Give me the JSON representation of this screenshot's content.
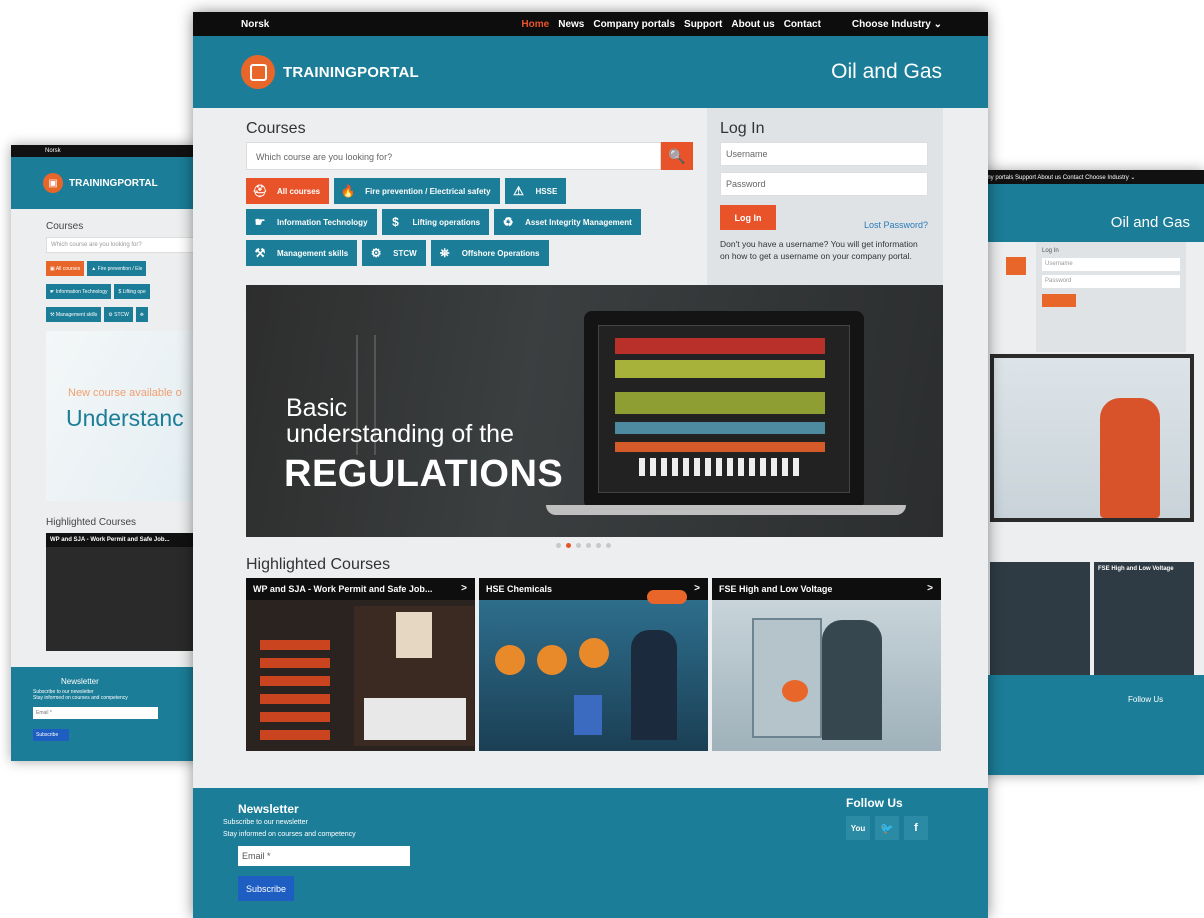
{
  "top_nav": {
    "language": "Norsk",
    "items": [
      "Home",
      "News",
      "Company portals",
      "Support",
      "About us",
      "Contact"
    ],
    "active": "Home",
    "industry_label": "Choose Industry",
    "industry_arrow": "⌄"
  },
  "header": {
    "brand": "TRAININGPORTAL",
    "industry": "Oil and Gas"
  },
  "courses": {
    "title": "Courses",
    "search_placeholder": "Which course are you looking for?",
    "search_icon": "🔍",
    "categories": [
      [
        {
          "label": "All courses",
          "icon": "⛑"
        },
        {
          "label": "Fire prevention / Electrical safety",
          "icon": "🔥"
        },
        {
          "label": "HSSE",
          "icon": "⚠"
        }
      ],
      [
        {
          "label": "Information Technology",
          "icon": "☛"
        },
        {
          "label": "Lifting operations",
          "icon": "$"
        },
        {
          "label": "Asset Integrity Management",
          "icon": "♻"
        }
      ],
      [
        {
          "label": "Management skills",
          "icon": "⚒"
        },
        {
          "label": "STCW",
          "icon": "⚙"
        },
        {
          "label": "Offshore Operations",
          "icon": "⛯"
        }
      ]
    ]
  },
  "login": {
    "title": "Log In",
    "username_placeholder": "Username",
    "password_placeholder": "Password",
    "button": "Log In",
    "lost_password": "Lost Password?",
    "note": "Don't you have a username? You will get information on how to get a username on your company portal."
  },
  "hero": {
    "line1": "Basic",
    "line2": "understanding of the",
    "line3": "REGULATIONS",
    "slides": 6,
    "active_slide": 2
  },
  "highlighted": {
    "title": "Highlighted Courses",
    "cards": [
      {
        "title": "WP and SJA - Work Permit and Safe Job...",
        "arrow": ">"
      },
      {
        "title": "HSE Chemicals",
        "arrow": ">"
      },
      {
        "title": "FSE High and Low Voltage",
        "arrow": ">"
      }
    ]
  },
  "footer": {
    "newsletter_title": "Newsletter",
    "newsletter_line1": "Subscribe to our newsletter",
    "newsletter_line2": "Stay informed on courses and competency",
    "email_placeholder": "Email *",
    "subscribe": "Subscribe",
    "follow_title": "Follow Us",
    "social": [
      "You Tube",
      "Twitter",
      "Facebook"
    ]
  },
  "bg_left": {
    "language": "Norsk",
    "brand": "TRAININGPORTAL",
    "courses": "Courses",
    "search_placeholder": "Which course are you looking for?",
    "hero_line1": "New course available o",
    "hero_line2": "Understanc",
    "highlighted": "Highlighted Courses",
    "card_title": "WP and SJA - Work Permit and Safe Job...",
    "newsletter": "Newsletter",
    "email": "Email *",
    "subscribe": "Subscribe"
  },
  "bg_right": {
    "topnav": "any portals  Support  About us  Contact        Choose Industry ⌄",
    "industry": "Oil and Gas",
    "login_title": "Log In",
    "username": "Username",
    "password": "Password",
    "card_title": "FSE High and Low Voltage",
    "follow": "Follow Us"
  },
  "colors": {
    "teal": "#1b7d97",
    "orange": "#e8532a",
    "dark": "#0d0d0d",
    "subscribe_blue": "#1e5ec2"
  }
}
